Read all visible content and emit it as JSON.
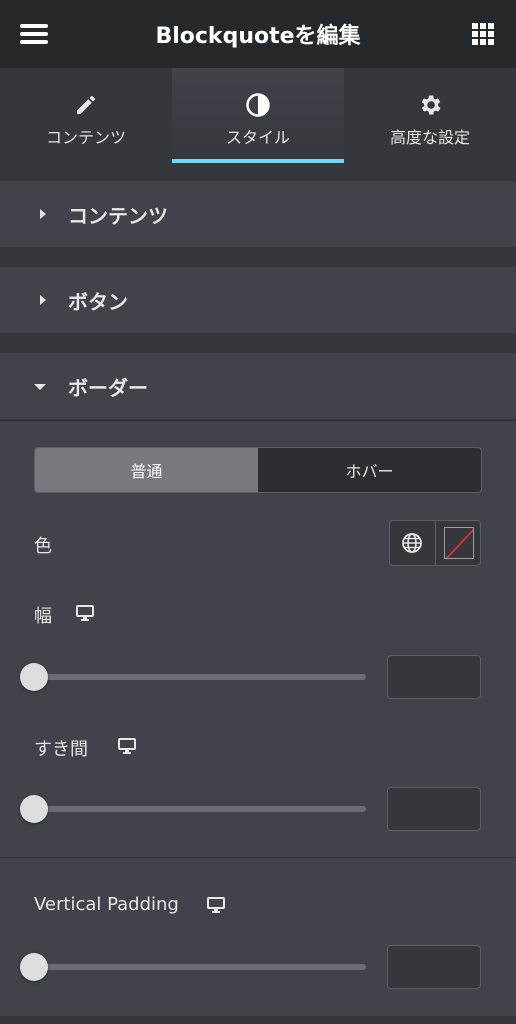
{
  "header": {
    "title": "Blockquoteを編集",
    "menu_icon": "hamburger-menu-icon",
    "apps_icon": "grid-apps-icon"
  },
  "tabs": [
    {
      "label": "コンテンツ",
      "icon": "pencil-icon",
      "active": false
    },
    {
      "label": "スタイル",
      "icon": "half-circle-contrast-icon",
      "active": true
    },
    {
      "label": "高度な設定",
      "icon": "gear-icon",
      "active": false
    }
  ],
  "sections": [
    {
      "label": "コンテンツ",
      "expanded": false
    },
    {
      "label": "ボタン",
      "expanded": false
    },
    {
      "label": "ボーダー",
      "expanded": true
    }
  ],
  "state_toggle": {
    "normal": "普通",
    "hover": "ホバー",
    "selected": "普通"
  },
  "controls": {
    "color_label": "色",
    "width_label": "幅",
    "gap_label": "すき間",
    "vertical_padding_label": "Vertical Padding"
  },
  "sliders": {
    "width_value": "",
    "gap_value": "",
    "vertical_padding_value": ""
  },
  "colors": {
    "accent": "#71d7f7",
    "header_bg": "#26292c",
    "panel_bg": "#404349",
    "page_bg": "#34373c"
  }
}
